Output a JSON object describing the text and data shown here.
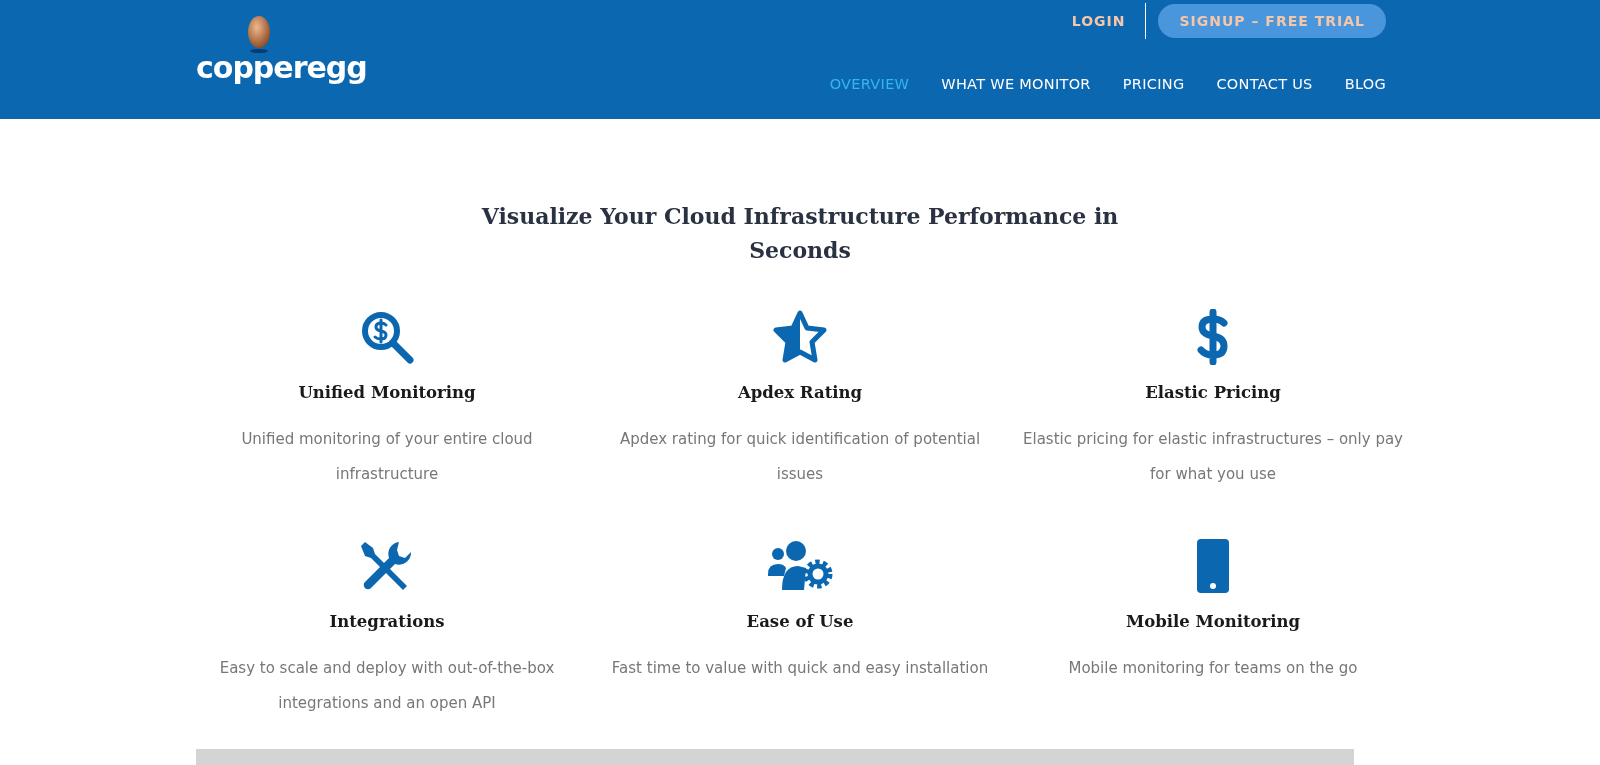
{
  "header": {
    "logo": "copperegg",
    "login": "LOGIN",
    "signup": "SIGNUP – FREE TRIAL",
    "nav": [
      {
        "label": "OVERVIEW",
        "selected": true
      },
      {
        "label": "WHAT WE MONITOR",
        "selected": false
      },
      {
        "label": "PRICING",
        "selected": false
      },
      {
        "label": "CONTACT US",
        "selected": false
      },
      {
        "label": "BLOG",
        "selected": false
      }
    ]
  },
  "heading": "Visualize Your Cloud Infrastructure Performance in Seconds",
  "features": [
    {
      "kind": "magnifier",
      "title": "Unified Monitoring",
      "text": "Unified monitoring of your entire cloud infrastructure"
    },
    {
      "kind": "star",
      "title": "Apdex Rating",
      "text": "Apdex rating for quick identification of potential issues"
    },
    {
      "kind": "dollar",
      "title": "Elastic Pricing",
      "text": "Elastic pricing for elastic infrastructures – only pay for what you use"
    },
    {
      "kind": "tools",
      "title": "Integrations",
      "text": "Easy to scale and deploy with out-of-the-box integrations and an open API"
    },
    {
      "kind": "users",
      "title": "Ease of Use",
      "text": "Fast time to value with quick and easy installation"
    },
    {
      "kind": "phone",
      "title": "Mobile Monitoring",
      "text": "Mobile monitoring for teams on the go"
    }
  ]
}
